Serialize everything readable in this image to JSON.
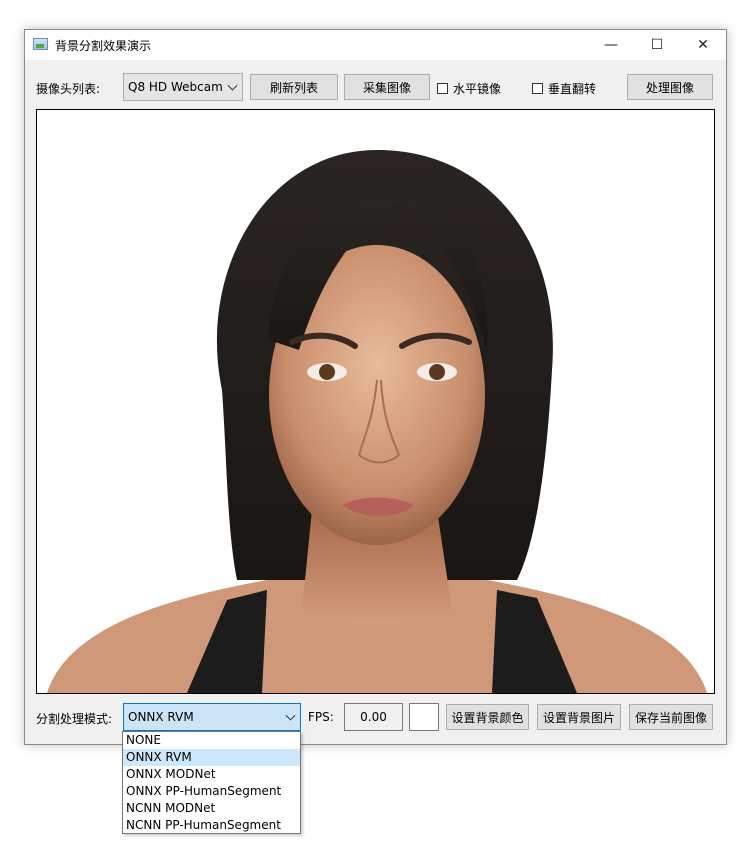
{
  "window": {
    "title": "背景分割效果演示",
    "icon": "app-image-icon",
    "controls": {
      "minimize": "—",
      "maximize": "☐",
      "close": "✕"
    }
  },
  "toolbar": {
    "camera_list_label": "摄像头列表:",
    "camera_selected": "Q8 HD Webcam",
    "refresh_label": "刷新列表",
    "capture_label": "采集图像",
    "mirror_label": "水平镜像",
    "mirror_checked": false,
    "flip_label": "垂直翻转",
    "flip_checked": false,
    "process_label": "处理图像"
  },
  "preview": {
    "description_icon": "portrait-image",
    "background_color": "#ffffff"
  },
  "bottom": {
    "mode_label": "分割处理模式:",
    "mode_selected": "ONNX RVM",
    "fps_label": "FPS:",
    "fps_value": "0.00",
    "bg_color_value": "#ffffff",
    "set_bg_color_label": "设置背景颜色",
    "set_bg_image_label": "设置背景图片",
    "save_image_label": "保存当前图像"
  },
  "mode_options": [
    {
      "label": "NONE",
      "selected": false
    },
    {
      "label": "ONNX RVM",
      "selected": true
    },
    {
      "label": "ONNX MODNet",
      "selected": false
    },
    {
      "label": "ONNX PP-HumanSegment",
      "selected": false
    },
    {
      "label": "NCNN MODNet",
      "selected": false
    },
    {
      "label": "NCNN PP-HumanSegment",
      "selected": false
    }
  ],
  "colors": {
    "accent": "#0078d7",
    "selection": "#cce8ff",
    "window_bg": "#f0f0f0"
  }
}
